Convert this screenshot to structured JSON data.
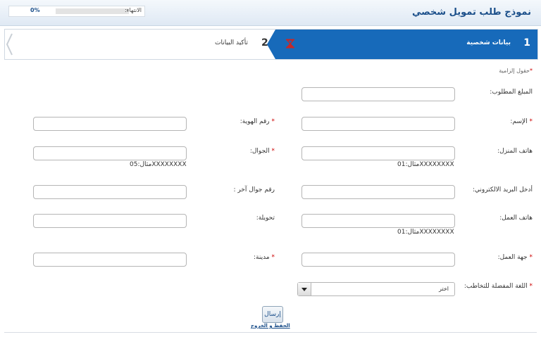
{
  "header": {
    "title": "نموذج طلب تمويل شخصي"
  },
  "progress": {
    "label": "الانتهاء:",
    "percent_text": "0%",
    "value": 0
  },
  "steps": [
    {
      "number": "1",
      "label": "بيانات شخصية",
      "active": true
    },
    {
      "number": "2",
      "label": "تأكيد البيانات",
      "active": false
    }
  ],
  "required_note": {
    "star": "*",
    "text": "حقول إلزامية"
  },
  "fields": {
    "amount": {
      "label": "المبلغ المطلوب:",
      "value": ""
    },
    "name": {
      "star": "*",
      "label": "الإسم:",
      "value": ""
    },
    "id_number": {
      "star": "*",
      "label": "رقم الهوية:",
      "value": ""
    },
    "home_phone": {
      "label": "هاتف المنزل:",
      "value": "",
      "hint": "مثال:01XXXXXXXX"
    },
    "mobile": {
      "star": "*",
      "label": "الجوال:",
      "value": "",
      "hint": "مثال:05XXXXXXXX"
    },
    "email": {
      "label": "أدخل البريد الالكتروني:",
      "value": ""
    },
    "other_mobile": {
      "label": "رقم جوال آخر :",
      "value": ""
    },
    "work_phone": {
      "label": "هاتف العمل:",
      "value": "",
      "hint": "مثال:01XXXXXXXX"
    },
    "extension": {
      "label": "تحويلة:",
      "value": ""
    },
    "employer": {
      "star": "*",
      "label": "جهة العمل:",
      "value": ""
    },
    "city": {
      "star": "*",
      "label": "مدينة:",
      "value": ""
    },
    "language": {
      "star": "*",
      "label": "اللغة المفضلة للتخاطب:",
      "selected": "اختر"
    }
  },
  "actions": {
    "submit": "إرسال",
    "save_exit": "الحفظ و الخروج"
  },
  "colors": {
    "accent": "#176aba",
    "title": "#1b4f8a",
    "required": "#cc0000"
  },
  "icons": {
    "step_status": "hourglass-icon",
    "nav": "chevron-left-icon",
    "dropdown": "triangle-down-icon"
  }
}
